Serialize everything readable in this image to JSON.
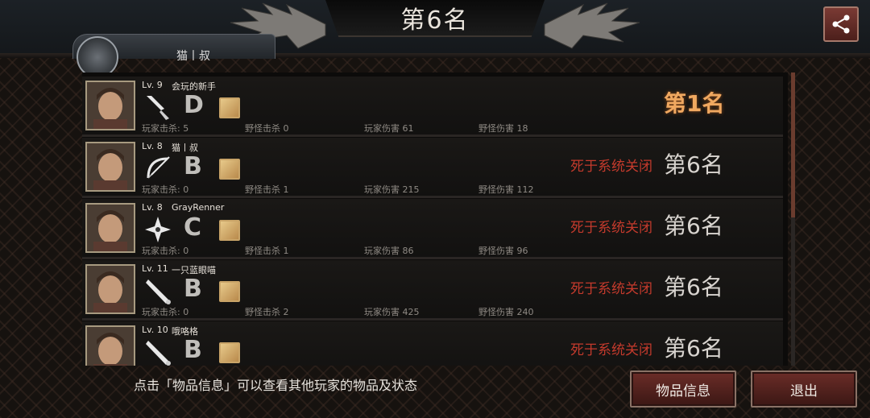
{
  "header": {
    "title": "第6名",
    "player_tab_name": "猫丨叔"
  },
  "players": [
    {
      "level": "Lv. 9",
      "name": "会玩的新手",
      "weapon": "knife-icon",
      "grade": "D",
      "item": "fist-item-icon",
      "player_kills": "玩家击杀: 5",
      "monster_kills": "野怪击杀 0",
      "player_damage": "玩家伤害 61",
      "monster_damage": "野怪伤害 18",
      "death_reason": "",
      "rank": "第1名",
      "first": true
    },
    {
      "level": "Lv. 8",
      "name": "猫丨叔",
      "weapon": "bow-icon",
      "grade": "B",
      "item": "hand-item-icon",
      "player_kills": "玩家击杀: 0",
      "monster_kills": "野怪击杀 1",
      "player_damage": "玩家伤害 215",
      "monster_damage": "野怪伤害 112",
      "death_reason": "死于系统关闭",
      "rank": "第6名",
      "first": false
    },
    {
      "level": "Lv. 8",
      "name": "GrayRenner",
      "weapon": "shuriken-icon",
      "grade": "C",
      "item": "hand-item-icon",
      "player_kills": "玩家击杀: 0",
      "monster_kills": "野怪击杀 1",
      "player_damage": "玩家伤害 86",
      "monster_damage": "野怪伤害 96",
      "death_reason": "死于系统关闭",
      "rank": "第6名",
      "first": false
    },
    {
      "level": "Lv. 11",
      "name": "一只蓝眼喵",
      "weapon": "bat-icon",
      "grade": "B",
      "item": "fist-item-icon",
      "player_kills": "玩家击杀: 0",
      "monster_kills": "野怪击杀 2",
      "player_damage": "玩家伤害 425",
      "monster_damage": "野怪伤害 240",
      "death_reason": "死于系统关闭",
      "rank": "第6名",
      "first": false
    },
    {
      "level": "Lv. 10",
      "name": "哦咯格",
      "weapon": "bat-icon",
      "grade": "B",
      "item": "hand-item-icon",
      "player_kills": "",
      "monster_kills": "",
      "player_damage": "",
      "monster_damage": "",
      "death_reason": "死于系统关闭",
      "rank": "第6名",
      "first": false
    }
  ],
  "footer": {
    "hint": "点击「物品信息」可以查看其他玩家的物品及状态",
    "items_button": "物品信息",
    "exit_button": "退出"
  },
  "colors": {
    "first_rank": "#f0a860",
    "death_text": "#c33a2c",
    "button": "#6b2d28"
  }
}
